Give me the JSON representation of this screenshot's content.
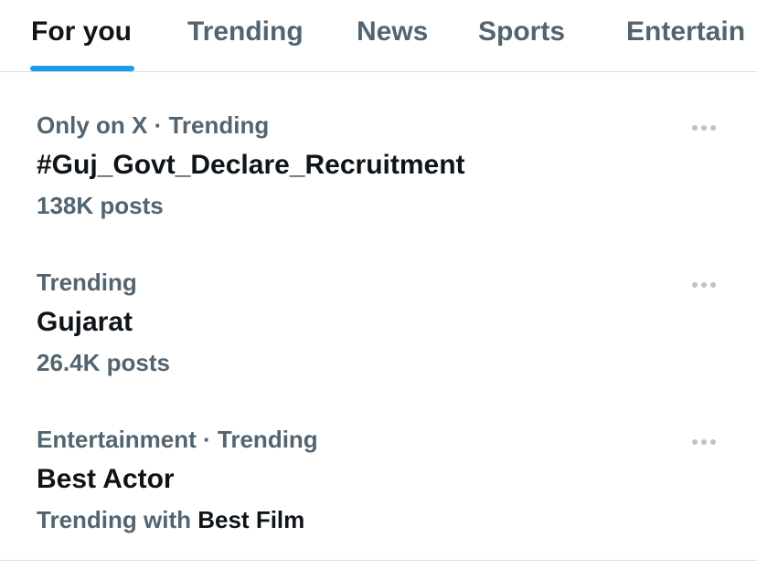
{
  "tabs": [
    {
      "label": "For you",
      "active": true
    },
    {
      "label": "Trending",
      "active": false
    },
    {
      "label": "News",
      "active": false
    },
    {
      "label": "Sports",
      "active": false
    },
    {
      "label": "Entertain",
      "active": false
    }
  ],
  "trends": [
    {
      "context": "Only on X · Trending",
      "name": "#Guj_Govt_Declare_Recruitment",
      "posts": "138K posts"
    },
    {
      "context": "Trending",
      "name": "Gujarat",
      "posts": "26.4K posts"
    },
    {
      "context": "Entertainment · Trending",
      "name": "Best Actor",
      "trending_with_label": "Trending with",
      "trending_with_value": "Best Film"
    }
  ],
  "icons": {
    "more": "more-horizontal-icon"
  },
  "colors": {
    "accent": "#1d9bf0",
    "primary_text": "#0f1419",
    "secondary_text": "#536471",
    "icon": "#b8c3cc",
    "divider": "#d6dde3"
  }
}
